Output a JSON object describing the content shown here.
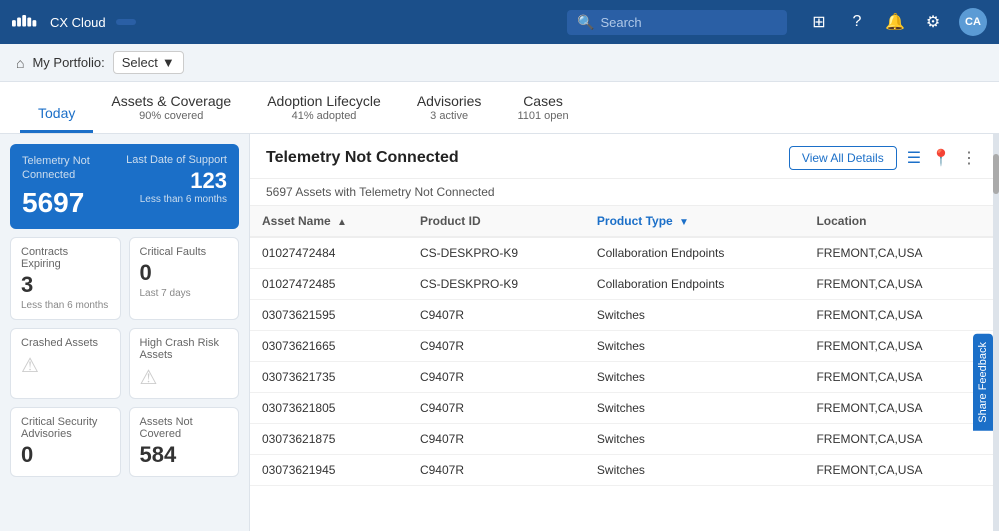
{
  "app": {
    "logo_text": "CX Cloud",
    "nav_label": "CX Cloud"
  },
  "search": {
    "placeholder": "Search"
  },
  "nav_icons": {
    "grid": "⊞",
    "help": "?",
    "bell": "🔔",
    "gear": "⚙",
    "avatar": "CA"
  },
  "portfolio": {
    "label": "My Portfolio:",
    "select_label": "Select",
    "home_icon": "⌂"
  },
  "tabs": [
    {
      "id": "today",
      "title": "Today",
      "subtitle": "",
      "active": true
    },
    {
      "id": "assets",
      "title": "Assets & Coverage",
      "subtitle": "90% covered",
      "active": false
    },
    {
      "id": "adoption",
      "title": "Adoption Lifecycle",
      "subtitle": "41% adopted",
      "active": false
    },
    {
      "id": "advisories",
      "title": "Advisories",
      "subtitle": "3 active",
      "active": false
    },
    {
      "id": "cases",
      "title": "Cases",
      "subtitle": "1101 open",
      "active": false
    }
  ],
  "left_panel": {
    "telemetry_card": {
      "label": "Telemetry Not Connected",
      "count": "5697",
      "right_label": "Last Date of Support",
      "right_count": "123",
      "right_sub": "Less than 6 months"
    },
    "contracts_expiring": {
      "title": "Contracts Expiring",
      "value": "3",
      "sub": "Less than 6 months"
    },
    "critical_faults": {
      "title": "Critical Faults",
      "value": "0",
      "sub": "Last 7 days"
    },
    "crashed_assets": {
      "title": "Crashed Assets",
      "icon": "⚠"
    },
    "high_crash_risk": {
      "title": "High Crash Risk Assets",
      "icon": "⚠"
    },
    "critical_security": {
      "title": "Critical Security Advisories",
      "value": "0"
    },
    "assets_not_covered": {
      "title": "Assets Not Covered",
      "value": "584"
    }
  },
  "right_panel": {
    "title": "Telemetry Not Connected",
    "view_all_label": "View All Details",
    "assets_count_text": "5697 Assets with Telemetry Not Connected",
    "columns": [
      {
        "id": "asset_name",
        "label": "Asset Name",
        "sort": "asc",
        "active": false
      },
      {
        "id": "product_id",
        "label": "Product ID",
        "sort": null,
        "active": false
      },
      {
        "id": "product_type",
        "label": "Product Type",
        "sort": "asc",
        "active": true
      },
      {
        "id": "location",
        "label": "Location",
        "sort": null,
        "active": false
      }
    ],
    "rows": [
      {
        "asset_name": "01027472484",
        "product_id": "CS-DESKPRO-K9",
        "product_type": "Collaboration Endpoints",
        "location": "FREMONT,CA,USA"
      },
      {
        "asset_name": "01027472485",
        "product_id": "CS-DESKPRO-K9",
        "product_type": "Collaboration Endpoints",
        "location": "FREMONT,CA,USA"
      },
      {
        "asset_name": "03073621595",
        "product_id": "C9407R",
        "product_type": "Switches",
        "location": "FREMONT,CA,USA"
      },
      {
        "asset_name": "03073621665",
        "product_id": "C9407R",
        "product_type": "Switches",
        "location": "FREMONT,CA,USA"
      },
      {
        "asset_name": "03073621735",
        "product_id": "C9407R",
        "product_type": "Switches",
        "location": "FREMONT,CA,USA"
      },
      {
        "asset_name": "03073621805",
        "product_id": "C9407R",
        "product_type": "Switches",
        "location": "FREMONT,CA,USA"
      },
      {
        "asset_name": "03073621875",
        "product_id": "C9407R",
        "product_type": "Switches",
        "location": "FREMONT,CA,USA"
      },
      {
        "asset_name": "03073621945",
        "product_id": "C9407R",
        "product_type": "Switches",
        "location": "FREMONT,CA,USA"
      }
    ],
    "feedback_label": "Share Feedback"
  }
}
